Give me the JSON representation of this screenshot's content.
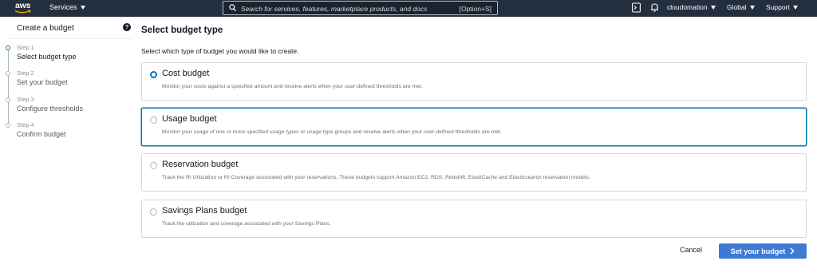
{
  "nav": {
    "logo_text": "aws",
    "services_label": "Services",
    "search_placeholder": "Search for services, features, marketplace products, and docs",
    "search_shortcut": "[Option+S]",
    "account": "cloudomation",
    "region": "Global",
    "support": "Support",
    "icons": [
      "terminal-icon",
      "bell-icon"
    ]
  },
  "sidebar": {
    "title": "Create a budget",
    "steps": [
      {
        "num": "Step 1",
        "label": "Select budget type"
      },
      {
        "num": "Step 2",
        "label": "Set your budget"
      },
      {
        "num": "Step 3",
        "label": "Configure thresholds"
      },
      {
        "num": "Step 4",
        "label": "Confirm budget"
      }
    ]
  },
  "main": {
    "title": "Select budget type",
    "subtitle": "Select which type of budget you would like to create.",
    "options": [
      {
        "title": "Cost budget",
        "desc": "Monitor your costs against a specified amount and receive alerts when your user-defined thresholds are met.",
        "selected": true
      },
      {
        "title": "Usage budget",
        "desc": "Monitor your usage of one or more specified usage types or usage type groups and receive alerts when your user-defined thresholds are met.",
        "selected": false
      },
      {
        "title": "Reservation budget",
        "desc": "Track the RI Utilization or RI Coverage associated with your reservations. These budgets support Amazon EC2, RDS, Redshift, ElastiCache and Elasticsearch reservation models.",
        "selected": false
      },
      {
        "title": "Savings Plans budget",
        "desc": "Track the utilization and coverage associated with your Savings Plans.",
        "selected": false
      }
    ],
    "cancel_label": "Cancel",
    "next_label": "Set your budget"
  },
  "colors": {
    "nav_bg": "#232f3e",
    "accent": "#0073bb",
    "primary_button": "#3d7ad6"
  }
}
